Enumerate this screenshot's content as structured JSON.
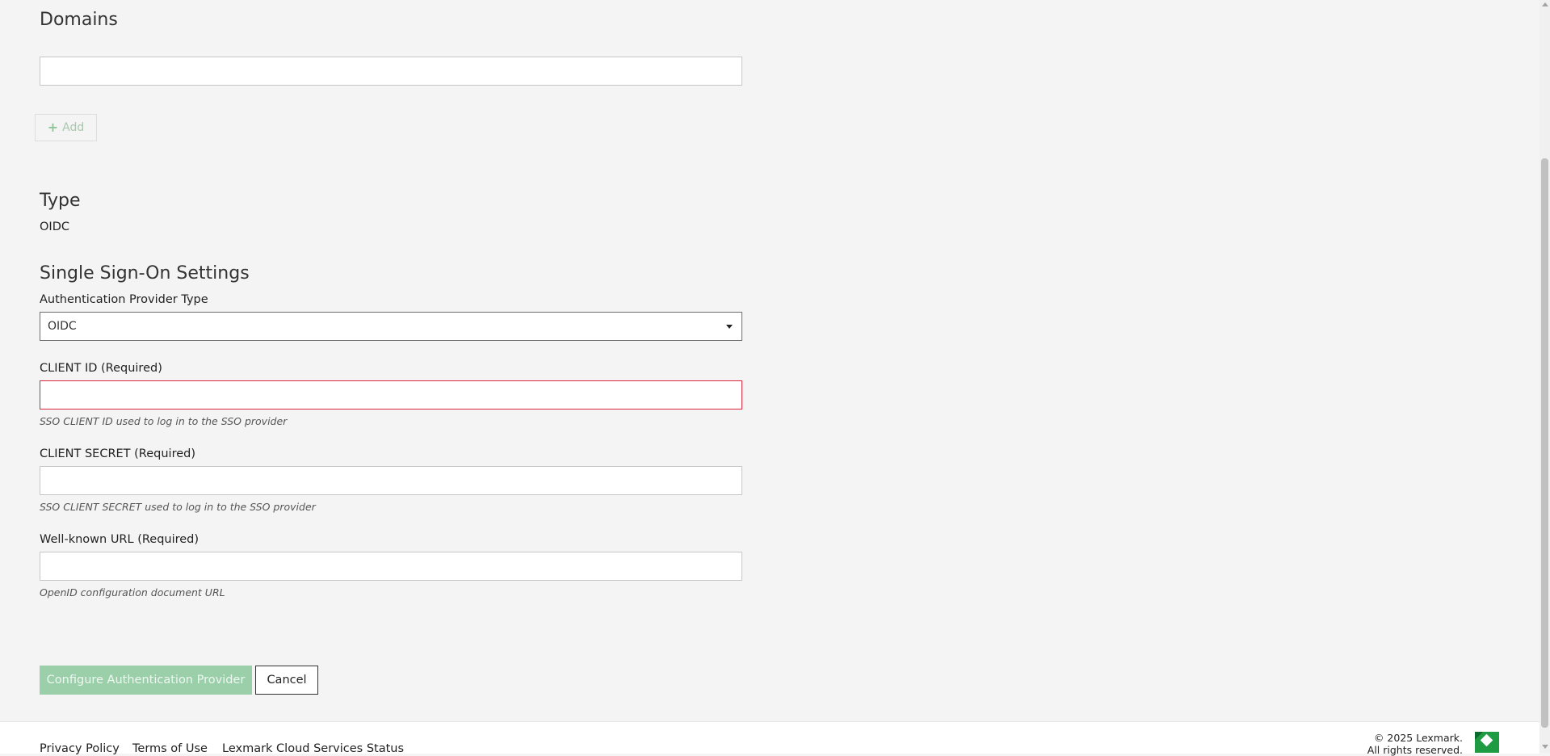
{
  "domains": {
    "title": "Domains",
    "input_value": "",
    "add_label": "Add"
  },
  "type_section": {
    "title": "Type",
    "value": "OIDC"
  },
  "sso": {
    "title": "Single Sign-On Settings",
    "provider_type_label": "Authentication Provider Type",
    "provider_type_value": "OIDC",
    "client_id_label": "CLIENT ID (Required)",
    "client_id_value": "",
    "client_id_help": "SSO CLIENT ID used to log in to the SSO provider",
    "client_secret_label": "CLIENT SECRET (Required)",
    "client_secret_value": "",
    "client_secret_help": "SSO CLIENT SECRET used to log in to the SSO provider",
    "wellknown_label": "Well-known URL (Required)",
    "wellknown_value": "",
    "wellknown_help": "OpenID configuration document URL"
  },
  "actions": {
    "configure_label": "Configure Authentication Provider",
    "cancel_label": "Cancel"
  },
  "footer": {
    "links": [
      "Privacy Policy",
      "Terms of Use",
      "Lexmark Cloud Services Status"
    ],
    "copyright_line1": "© 2025 Lexmark.",
    "copyright_line2": "All rights reserved."
  },
  "colors": {
    "accent": "#9bcfaa",
    "error_border": "#d9263c",
    "logo_green": "#1f9b44",
    "background": "#f4f4f4"
  },
  "icons": {
    "add": "plus-icon",
    "select": "caret-down-icon",
    "logo": "lexmark-logo-icon"
  }
}
